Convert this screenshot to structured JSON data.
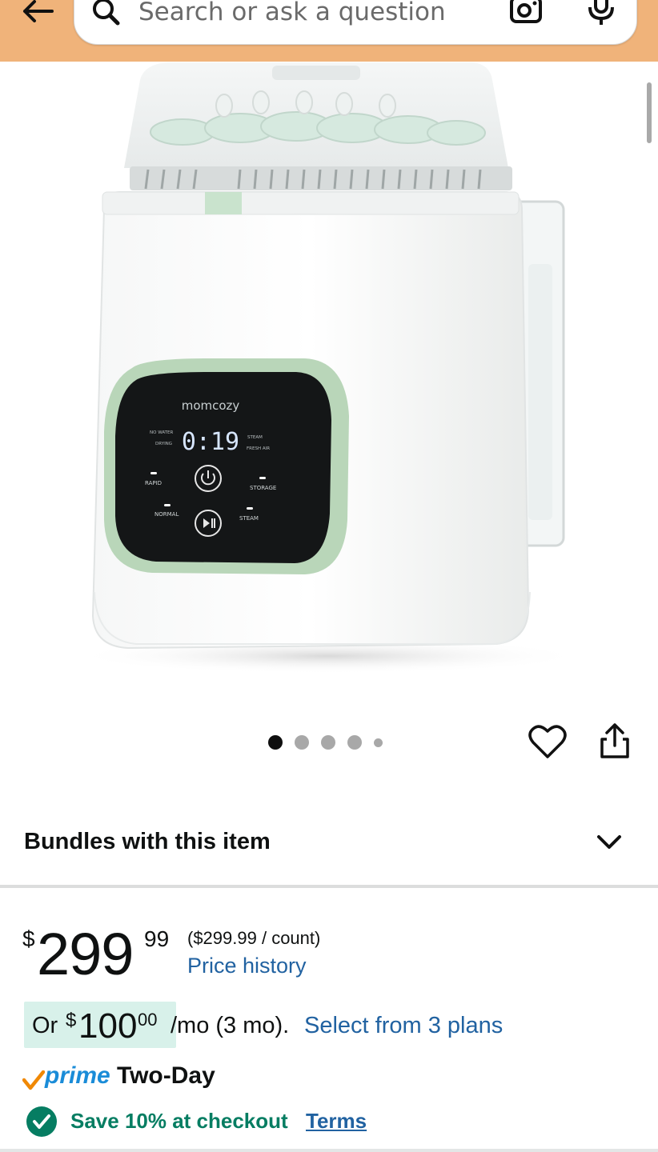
{
  "header": {
    "search_placeholder": "Search or ask a question",
    "icons": [
      "back-arrow-icon",
      "search-icon",
      "camera-icon",
      "microphone-icon"
    ]
  },
  "product_image": {
    "brand_label": "momcozy",
    "display_digits": "0:19",
    "panel_labels": {
      "no_water": "NO WATER",
      "drying": "DRYING",
      "steam_top": "STEAM",
      "fresh_air": "FRESH AIR",
      "rapid": "RAPID",
      "storage": "STORAGE",
      "normal": "NORMAL",
      "steam_bottom": "STEAM"
    }
  },
  "carousel": {
    "total_images": 5,
    "active_index": 0
  },
  "bundles": {
    "title": "Bundles with this item"
  },
  "price": {
    "symbol": "$",
    "whole": "299",
    "fraction": "99",
    "unit_price": "($299.99 / count)",
    "history_link": "Price history"
  },
  "installments": {
    "prefix": "Or",
    "symbol": "$",
    "whole": "100",
    "fraction": "00",
    "term": "/mo (3 mo).",
    "plans_link": "Select from 3 plans"
  },
  "prime": {
    "word": "prime",
    "speed": "Two-Day"
  },
  "coupon": {
    "text": "Save 10% at checkout",
    "terms_link": "Terms"
  },
  "colors": {
    "header_bg": "#f0b37a",
    "link": "#2162a1",
    "savings_green": "#067d62",
    "install_highlight": "#d8f1ea",
    "prime_blue": "#1a8cd8"
  }
}
